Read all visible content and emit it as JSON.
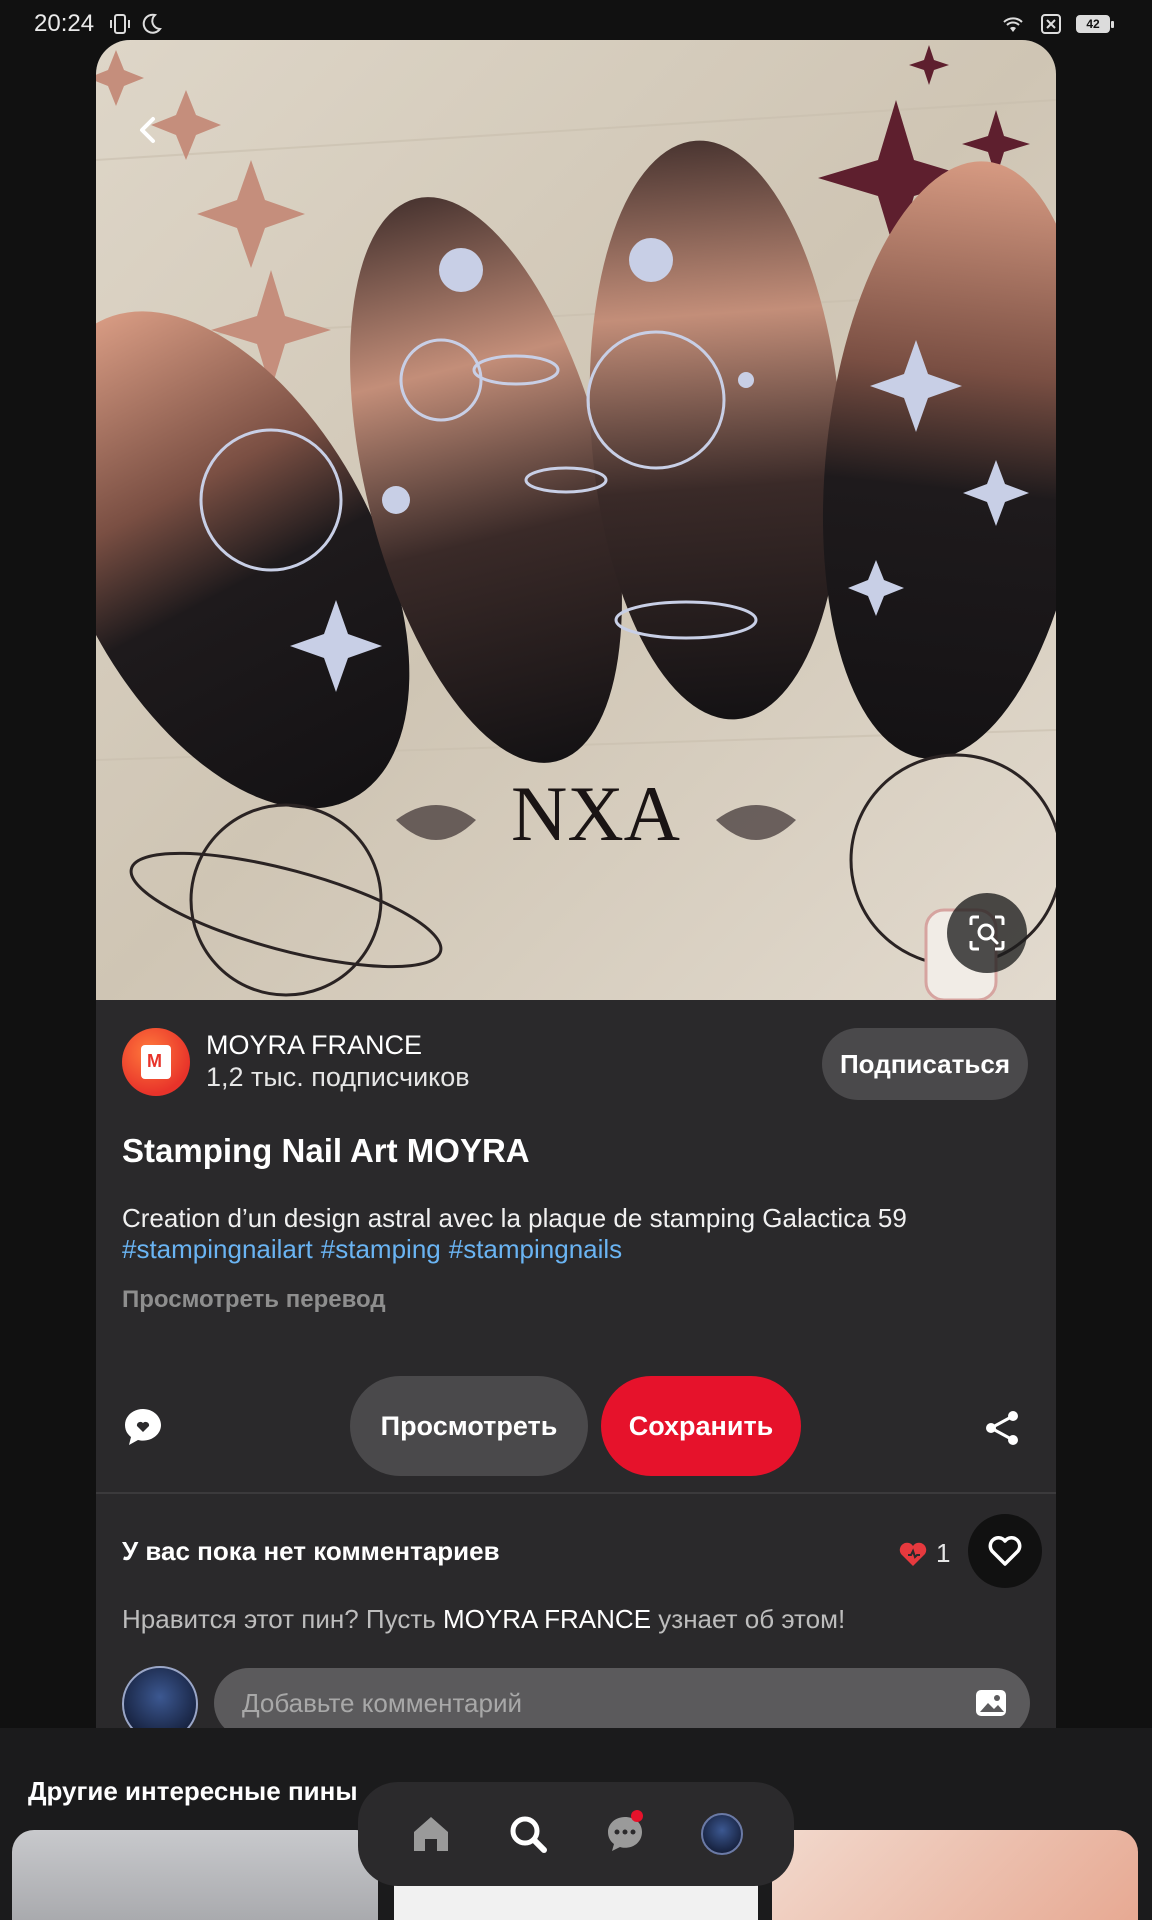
{
  "status_bar": {
    "time": "20:24",
    "battery": "42"
  },
  "pin": {
    "image_watermark": "NXA",
    "creator": {
      "name": "MOYRA FRANCE",
      "subscribers": "1,2 тыс. подписчиков",
      "follow_label": "Подписаться",
      "avatar_text": "Moyra"
    },
    "title": "Stamping Nail Art MOYRA",
    "description": "Creation d’un design astral avec la plaque de stamping Galactica 59",
    "hashtags": [
      "#stampingnailart",
      "#stamping",
      "#stampingnails"
    ],
    "translate_label": "Просмотреть перевод",
    "actions": {
      "view_label": "Просмотреть",
      "save_label": "Сохранить"
    }
  },
  "comments": {
    "empty_label": "У вас пока нет комментариев",
    "reaction_count": "1",
    "prompt_before": "Нравится этот пин? Пусть ",
    "prompt_name": "MOYRA FRANCE",
    "prompt_after": " узнает об этом!",
    "input_placeholder": "Добавьте комментарий"
  },
  "more_pins": {
    "title": "Другие интересные пины"
  },
  "colors": {
    "accent_red": "#e6122b",
    "link_blue": "#6ab4f3",
    "card_bg": "#2a292b"
  },
  "icons": [
    "back-icon",
    "more-icon",
    "visual-search-icon",
    "comment-icon",
    "share-icon",
    "heart-icon",
    "image-icon",
    "home-icon",
    "search-icon",
    "messages-icon"
  ]
}
